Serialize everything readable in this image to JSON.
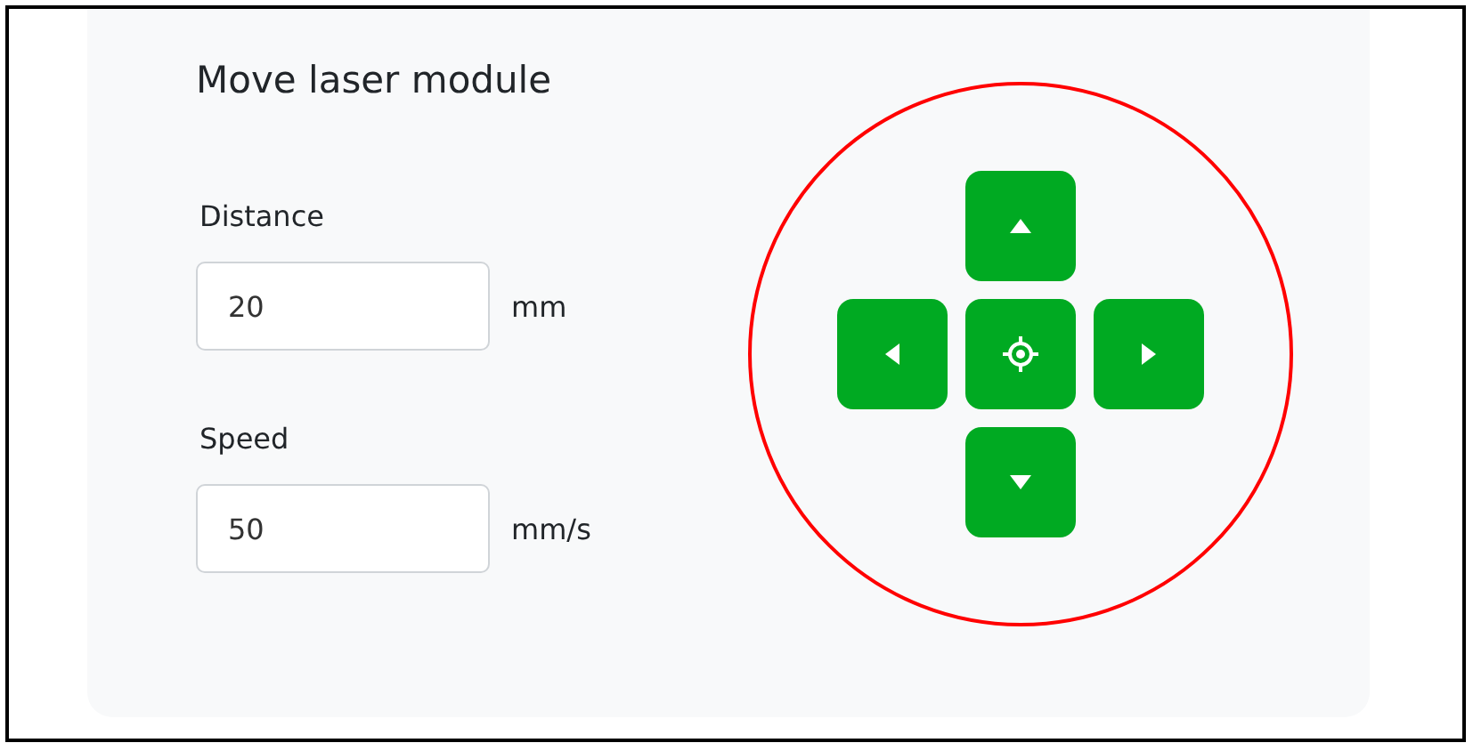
{
  "title": "Move laser module",
  "fields": [
    {
      "label": "Distance",
      "value": "20",
      "unit": "mm"
    },
    {
      "label": "Speed",
      "value": "50",
      "unit": "mm/s"
    }
  ],
  "jog_pad": {
    "buttons": [
      {
        "kind": "up"
      },
      {
        "kind": "left"
      },
      {
        "kind": "home"
      },
      {
        "kind": "right"
      },
      {
        "kind": "down"
      }
    ]
  }
}
